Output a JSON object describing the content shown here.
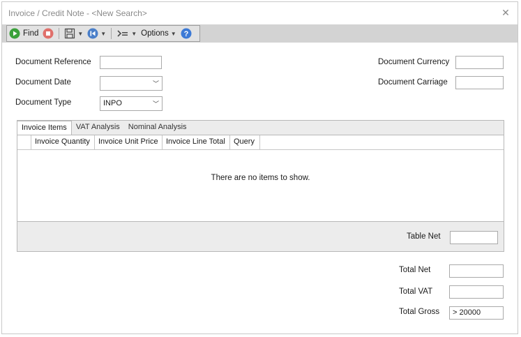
{
  "window": {
    "title": "Invoice / Credit Note - <New Search>"
  },
  "toolbar": {
    "find_label": "Find",
    "options_label": "Options"
  },
  "form": {
    "doc_ref_label": "Document Reference",
    "doc_ref_value": "",
    "doc_date_label": "Document Date",
    "doc_date_value": "",
    "doc_type_label": "Document Type",
    "doc_type_value": "INPO",
    "doc_currency_label": "Document Currency",
    "doc_currency_value": "",
    "doc_carriage_label": "Document Carriage",
    "doc_carriage_value": ""
  },
  "tabs": [
    "Invoice Items",
    "VAT Analysis",
    "Nominal Analysis"
  ],
  "grid": {
    "columns": [
      "Invoice Quantity",
      "Invoice Unit Price",
      "Invoice Line Total",
      "Query"
    ],
    "empty_message": "There are no items to show."
  },
  "totals": {
    "table_net_label": "Table Net",
    "table_net_value": "",
    "total_net_label": "Total Net",
    "total_net_value": "",
    "total_vat_label": "Total VAT",
    "total_vat_value": "",
    "total_gross_label": "Total Gross",
    "total_gross_value": "> 20000"
  },
  "icons": {
    "find": "play-icon",
    "stop": "stop-icon",
    "save": "save-icon",
    "navigate": "navigate-first-icon",
    "commands": "command-icon",
    "help": "help-icon"
  },
  "colors": {
    "find_green": "#3aa13a",
    "stop_red": "#e0706b",
    "nav_blue": "#4a7fc9",
    "help_blue": "#3c7ad6"
  }
}
